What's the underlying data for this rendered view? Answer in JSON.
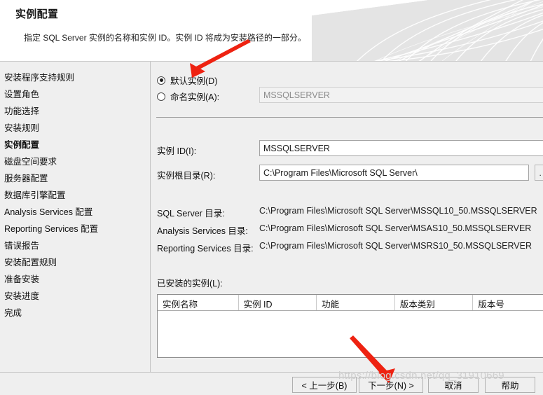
{
  "header": {
    "title": "实例配置",
    "subtitle": "指定 SQL Server 实例的名称和实例 ID。实例 ID 将成为安装路径的一部分。"
  },
  "sidebar": {
    "items": [
      {
        "label": "安装程序支持规则",
        "current": false
      },
      {
        "label": "设置角色",
        "current": false
      },
      {
        "label": "功能选择",
        "current": false
      },
      {
        "label": "安装规则",
        "current": false
      },
      {
        "label": "实例配置",
        "current": true
      },
      {
        "label": "磁盘空间要求",
        "current": false
      },
      {
        "label": "服务器配置",
        "current": false
      },
      {
        "label": "数据库引擎配置",
        "current": false
      },
      {
        "label": "Analysis Services 配置",
        "current": false
      },
      {
        "label": "Reporting Services 配置",
        "current": false
      },
      {
        "label": "错误报告",
        "current": false
      },
      {
        "label": "安装配置规则",
        "current": false
      },
      {
        "label": "准备安装",
        "current": false
      },
      {
        "label": "安装进度",
        "current": false
      },
      {
        "label": "完成",
        "current": false
      }
    ]
  },
  "main": {
    "default_instance": {
      "label": "默认实例(D)",
      "selected": true
    },
    "named_instance": {
      "label": "命名实例(A):",
      "selected": false,
      "value": "MSSQLSERVER"
    },
    "instance_id": {
      "label": "实例 ID(I):",
      "value": "MSSQLSERVER"
    },
    "instance_root": {
      "label": "实例根目录(R):",
      "value": "C:\\Program Files\\Microsoft SQL Server\\",
      "browse_label": "..."
    },
    "paths": [
      {
        "label": "SQL Server 目录:",
        "value": "C:\\Program Files\\Microsoft SQL Server\\MSSQL10_50.MSSQLSERVER"
      },
      {
        "label": "Analysis Services 目录:",
        "value": "C:\\Program Files\\Microsoft SQL Server\\MSAS10_50.MSSQLSERVER"
      },
      {
        "label": "Reporting Services 目录:",
        "value": "C:\\Program Files\\Microsoft SQL Server\\MSRS10_50.MSSQLSERVER"
      }
    ],
    "installed_instances": {
      "label": "已安装的实例(L):",
      "columns": [
        "实例名称",
        "实例 ID",
        "功能",
        "版本类别",
        "版本号"
      ],
      "rows": []
    }
  },
  "footer": {
    "back": "< 上一步(B)",
    "next": "下一步(N) >",
    "cancel": "取消",
    "help": "帮助"
  },
  "annotations": {
    "watermark": "https://blog.csdn.net/qq_31910669",
    "arrow_color": "#ee2211"
  }
}
